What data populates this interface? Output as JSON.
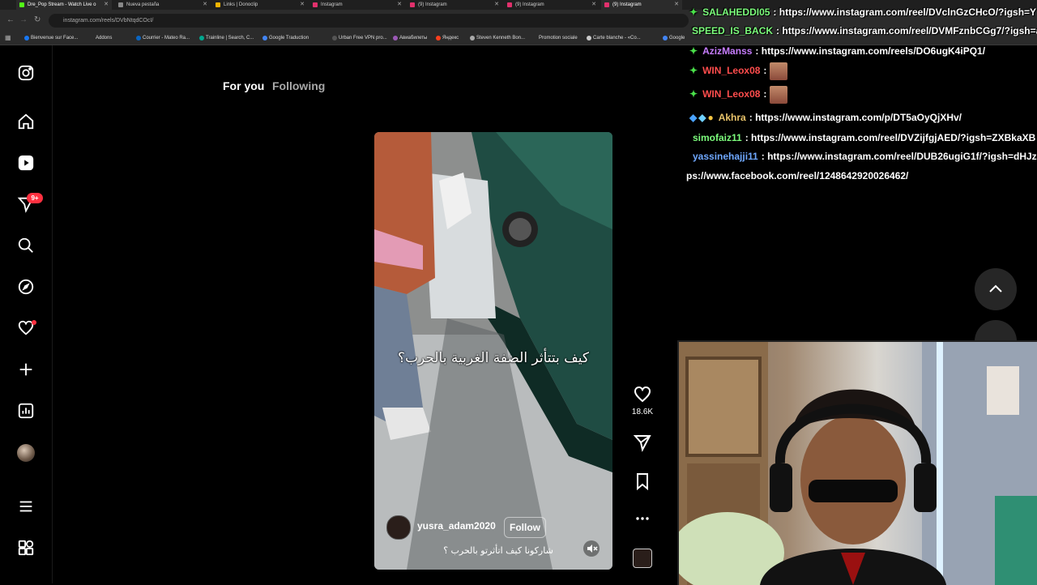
{
  "browser": {
    "tabs": [
      {
        "title": "Dre_Pop Stream - Watch Live o",
        "color": "#53fc18"
      },
      {
        "title": "Nueva pestaña",
        "color": "#888888"
      },
      {
        "title": "Links | Donoclip",
        "color": "#f4b400"
      },
      {
        "title": "Instagram",
        "color": "#e1306c"
      },
      {
        "title": "(9) Instagram",
        "color": "#e1306c"
      },
      {
        "title": "(9) Instagram",
        "color": "#e1306c"
      },
      {
        "title": "(9) Instagram",
        "color": "#e1306c"
      }
    ],
    "url": "instagram.com/reels/DVbNtqdCOcI/",
    "bookmarks": [
      "Bienvenue sur Face...",
      "Addons",
      "Courrier - Mateo Ra...",
      "Trainline | Search, C...",
      "Google Traduction",
      "Urban Free VPN pro...",
      "Авиабилеты",
      "Яндекс",
      "Steven Kenneth Bon...",
      "Promotion sociale",
      "Carte blanche - «Co...",
      "Google"
    ]
  },
  "instagram": {
    "nav": {
      "notification_badge": "9+"
    },
    "feed_tabs": {
      "for_you": "For you",
      "following": "Following"
    },
    "reel": {
      "overlay_text": "كيف بتتأثر الضفة الغربية بالحرب؟",
      "username": "yusra_adam2020",
      "follow_label": "Follow",
      "caption": "شاركونا كيف اتأثرتو بالحرب ؟",
      "like_count": "18.6K"
    }
  },
  "chat": [
    {
      "user": "SALAHEDDI05",
      "color": "#7cfc7c",
      "text": ": https://www.instagram.com/reel/DVclnGzCHcO/?igsh=Y"
    },
    {
      "user": "SPEED_IS_BACK",
      "color": "#7cfc7c",
      "text": ": https://www.instagram.com/reel/DVMFznbCGg7/?igsh=a"
    },
    {
      "user": "AzizManss",
      "color": "#c77dff",
      "text": ": https://www.instagram.com/reels/DO6ugK4iPQ1/"
    },
    {
      "user": "WIN_Leox08",
      "color": "#ff4d4d",
      "text": ":"
    },
    {
      "user": "WIN_Leox08",
      "color": "#ff4d4d",
      "text": ":"
    },
    {
      "user": "Akhra",
      "color": "#e8c36a",
      "text": ": https://www.instagram.com/p/DT5aOyQjXHv/"
    },
    {
      "user": "simofaiz11",
      "color": "#7cfc7c",
      "text": ": https://www.instagram.com/reel/DVZijfgjAED/?igsh=ZXBkaXB"
    },
    {
      "user": "yassinehajji11",
      "color": "#6fa8ff",
      "text": ": https://www.instagram.com/reel/DUB26ugiG1f/?igsh=dHJz"
    },
    {
      "user": "",
      "color": "#ffffff",
      "text": "ps://www.facebook.com/reel/1248642920026462/"
    }
  ]
}
